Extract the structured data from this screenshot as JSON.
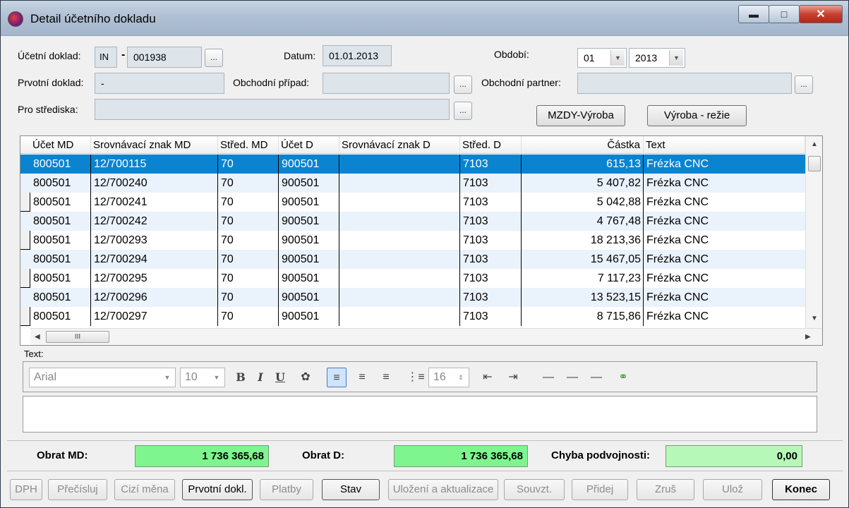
{
  "window": {
    "title": "Detail účetního dokladu"
  },
  "header": {
    "ucetni_doklad_label": "Účetní doklad:",
    "ucetni_doklad_prefix": "IN",
    "ucetni_doklad_number": "001938",
    "datum_label": "Datum:",
    "datum_value": "01.01.2013",
    "obdobi_label": "Období:",
    "obdobi_month": "01",
    "obdobi_year": "2013",
    "prvotni_doklad_label": "Prvotní doklad:",
    "prvotni_doklad_value": "-",
    "obchodni_pripad_label": "Obchodní případ:",
    "obchodni_pripad_value": "",
    "obchodni_partner_label": "Obchodní partner:",
    "obchodni_partner_value": "",
    "pro_strediska_label": "Pro střediska:",
    "pro_strediska_value": "",
    "ellipsis": "...",
    "btn_mzdy": "MZDY-Výroba",
    "btn_vyroba": "Výroba - režie"
  },
  "grid": {
    "columns": [
      "Účet MD",
      "Srovnávací znak MD",
      "Střed. MD",
      "Účet D",
      "Srovnávací znak D",
      "Střed. D",
      "Částka",
      "Text"
    ],
    "rows": [
      [
        "800501",
        "12/700115",
        "70",
        "900501",
        "",
        "7103",
        "615,13",
        "Frézka CNC"
      ],
      [
        "800501",
        "12/700240",
        "70",
        "900501",
        "",
        "7103",
        "5 407,82",
        "Frézka CNC"
      ],
      [
        "800501",
        "12/700241",
        "70",
        "900501",
        "",
        "7103",
        "5 042,88",
        "Frézka CNC"
      ],
      [
        "800501",
        "12/700242",
        "70",
        "900501",
        "",
        "7103",
        "4 767,48",
        "Frézka CNC"
      ],
      [
        "800501",
        "12/700293",
        "70",
        "900501",
        "",
        "7103",
        "18 213,36",
        "Frézka CNC"
      ],
      [
        "800501",
        "12/700294",
        "70",
        "900501",
        "",
        "7103",
        "15 467,05",
        "Frézka CNC"
      ],
      [
        "800501",
        "12/700295",
        "70",
        "900501",
        "",
        "7103",
        "7 117,23",
        "Frézka CNC"
      ],
      [
        "800501",
        "12/700296",
        "70",
        "900501",
        "",
        "7103",
        "13 523,15",
        "Frézka CNC"
      ],
      [
        "800501",
        "12/700297",
        "70",
        "900501",
        "",
        "7103",
        "8 715,86",
        "Frézka CNC"
      ]
    ],
    "scroll_thumb_label": "III"
  },
  "text_section": {
    "label": "Text:",
    "font_family": "Arial",
    "font_size": "10",
    "spacing_value": "16"
  },
  "totals": {
    "obrat_md_label": "Obrat MD:",
    "obrat_md_value": "1 736 365,68",
    "obrat_d_label": "Obrat D:",
    "obrat_d_value": "1 736 365,68",
    "chyba_label": "Chyba podvojnosti:",
    "chyba_value": "0,00"
  },
  "buttons": {
    "dph": "DPH",
    "precisluj": "Přečísluj",
    "cizi_mena": "Cizí měna",
    "prvotni_dokl": "Prvotní dokl.",
    "platby": "Platby",
    "stav": "Stav",
    "ulozeni": "Uložení a aktualizace",
    "souvzt": "Souvzt.",
    "pridej": "Přidej",
    "zrus": "Zruš",
    "uloz": "Ulož",
    "konec": "Konec"
  }
}
